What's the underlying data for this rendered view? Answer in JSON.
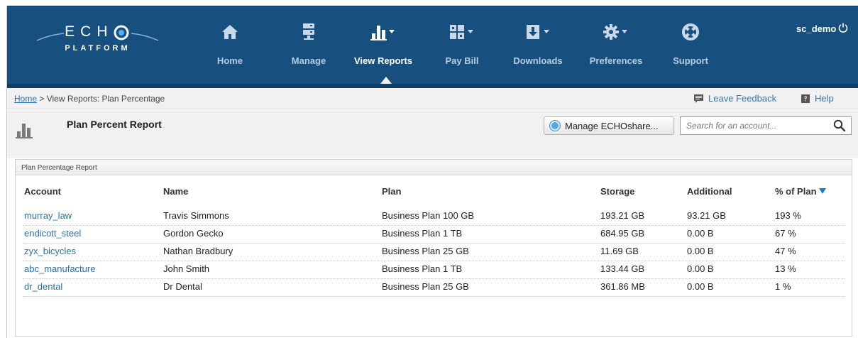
{
  "brand": {
    "logo_top": "ECH",
    "logo_o": "O",
    "logo_bottom": "PLATFORM"
  },
  "nav": [
    {
      "label": "Home",
      "icon": "home-icon"
    },
    {
      "label": "Manage",
      "icon": "server-icon"
    },
    {
      "label": "View Reports",
      "icon": "bar-chart-icon"
    },
    {
      "label": "Pay Bill",
      "icon": "grid-icon"
    },
    {
      "label": "Downloads",
      "icon": "download-icon"
    },
    {
      "label": "Preferences",
      "icon": "gear-icon"
    },
    {
      "label": "Support",
      "icon": "lifebuoy-icon"
    }
  ],
  "active_nav": "View Reports",
  "user": {
    "name": "sc_demo",
    "icon": "power-icon"
  },
  "breadcrumb": {
    "home": "Home",
    "rest": " > View Reports: Plan Percentage"
  },
  "links": {
    "feedback": "Leave Feedback",
    "help": "Help"
  },
  "page": {
    "title": "Plan Percent Report"
  },
  "actions": {
    "manage_share": "Manage ECHOshare..."
  },
  "search": {
    "placeholder": "Search for an account..."
  },
  "panel": {
    "title": "Plan Percentage Report"
  },
  "table": {
    "headers": {
      "account": "Account",
      "name": "Name",
      "plan": "Plan",
      "storage": "Storage",
      "additional": "Additional",
      "pct": "% of Plan"
    },
    "sort_column": "% of Plan",
    "sort_direction": "descending",
    "rows": [
      {
        "account": "murray_law",
        "name": "Travis Simmons",
        "plan": "Business Plan 100 GB",
        "storage": "193.21 GB",
        "additional": "93.21 GB",
        "pct": "193 %"
      },
      {
        "account": "endicott_steel",
        "name": "Gordon Gecko",
        "plan": "Business Plan 1 TB",
        "storage": "684.95 GB",
        "additional": "0.00 B",
        "pct": "67 %"
      },
      {
        "account": "zyx_bicycles",
        "name": "Nathan Bradbury",
        "plan": "Business Plan 25 GB",
        "storage": "11.69 GB",
        "additional": "0.00 B",
        "pct": "47 %"
      },
      {
        "account": "abc_manufacture",
        "name": "John Smith",
        "plan": "Business Plan 1 TB",
        "storage": "133.44 GB",
        "additional": "0.00 B",
        "pct": "13 %"
      },
      {
        "account": "dr_dental",
        "name": "Dr Dental",
        "plan": "Business Plan 25 GB",
        "storage": "361.86 MB",
        "additional": "0.00 B",
        "pct": "1 %"
      }
    ]
  },
  "colors": {
    "header_bg": "#17507e",
    "nav_label": "#b4cde2",
    "link": "#2a6fa8",
    "sort_arrow": "#1a7fd0"
  }
}
